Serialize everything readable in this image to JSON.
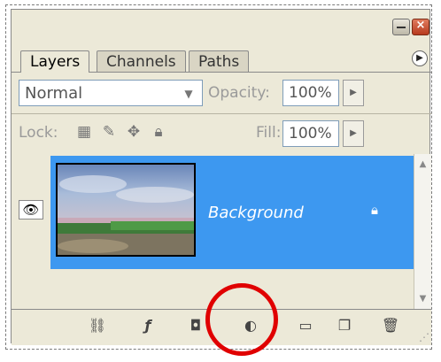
{
  "tabs": [
    {
      "label": "Layers",
      "active": true
    },
    {
      "label": "Channels",
      "active": false
    },
    {
      "label": "Paths",
      "active": false
    }
  ],
  "blend": {
    "mode": "Normal"
  },
  "opacity": {
    "label": "Opacity:",
    "value": "100%"
  },
  "lock": {
    "label": "Lock:"
  },
  "fill": {
    "label": "Fill:",
    "value": "100%"
  },
  "layer": {
    "name": "Background",
    "selected": true,
    "visible": true
  },
  "icons": {
    "link": "link-icon",
    "styles": "layer-style-icon",
    "mask": "mask-icon",
    "adjustment": "adjustment-layer-icon",
    "group": "folder-icon",
    "new": "new-layer-icon",
    "trash": "trash-icon"
  },
  "colors": {
    "selection": "#3d98f0",
    "highlight": "#e00000",
    "panel": "#ece9d8"
  }
}
